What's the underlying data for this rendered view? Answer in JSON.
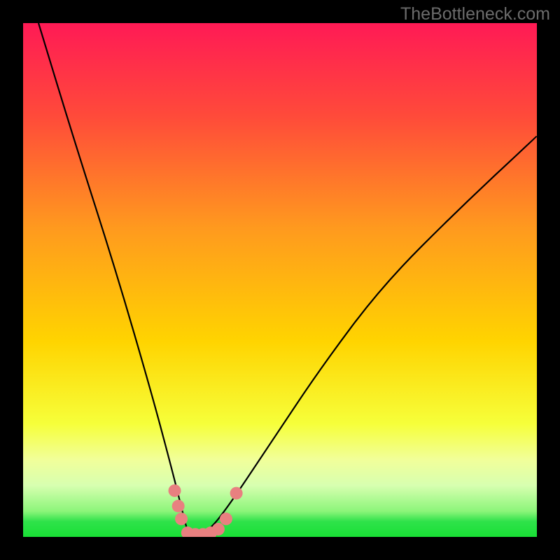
{
  "watermark": "TheBottleneck.com",
  "colors": {
    "frame": "#000000",
    "curve": "#000000",
    "markers": "#e88080",
    "green_band": "#19e035",
    "gradient_top": "#ff1a55",
    "gradient_mid": "#ffd400",
    "gradient_low": "#f1ff60"
  },
  "chart_data": {
    "type": "line",
    "title": "",
    "xlabel": "",
    "ylabel": "",
    "x_range": [
      0,
      100
    ],
    "y_range": [
      0,
      100
    ],
    "notch_x": 33,
    "curve_left": {
      "note": "steep descending branch from top-left down to notch",
      "x": [
        3,
        10,
        18,
        25,
        29,
        31,
        32,
        33
      ],
      "y": [
        100,
        77,
        52,
        28,
        13,
        5,
        1,
        0
      ]
    },
    "curve_right": {
      "note": "rising branch from notch toward upper-right, concave",
      "x": [
        33,
        36,
        40,
        48,
        58,
        70,
        85,
        100
      ],
      "y": [
        0,
        1,
        6,
        18,
        33,
        49,
        64,
        78
      ]
    },
    "markers": {
      "note": "salmon dots clustered at the bottom of the notch",
      "points": [
        {
          "x": 29.5,
          "y": 9
        },
        {
          "x": 30.2,
          "y": 6
        },
        {
          "x": 30.8,
          "y": 3.5
        },
        {
          "x": 32.0,
          "y": 0.8
        },
        {
          "x": 33.5,
          "y": 0.5
        },
        {
          "x": 35.0,
          "y": 0.5
        },
        {
          "x": 36.5,
          "y": 0.8
        },
        {
          "x": 38.0,
          "y": 1.5
        },
        {
          "x": 39.5,
          "y": 3.5
        },
        {
          "x": 41.5,
          "y": 8.5
        }
      ]
    },
    "gradient_stops": [
      {
        "pct": 0,
        "color": "#ff1a55"
      },
      {
        "pct": 18,
        "color": "#ff4a3a"
      },
      {
        "pct": 40,
        "color": "#ff9a1e"
      },
      {
        "pct": 62,
        "color": "#ffd400"
      },
      {
        "pct": 78,
        "color": "#f6ff3a"
      },
      {
        "pct": 85,
        "color": "#f1ff9a"
      },
      {
        "pct": 90,
        "color": "#d7ffb0"
      },
      {
        "pct": 95,
        "color": "#8cf57a"
      },
      {
        "pct": 97,
        "color": "#2fe24a"
      },
      {
        "pct": 100,
        "color": "#19e035"
      }
    ]
  }
}
